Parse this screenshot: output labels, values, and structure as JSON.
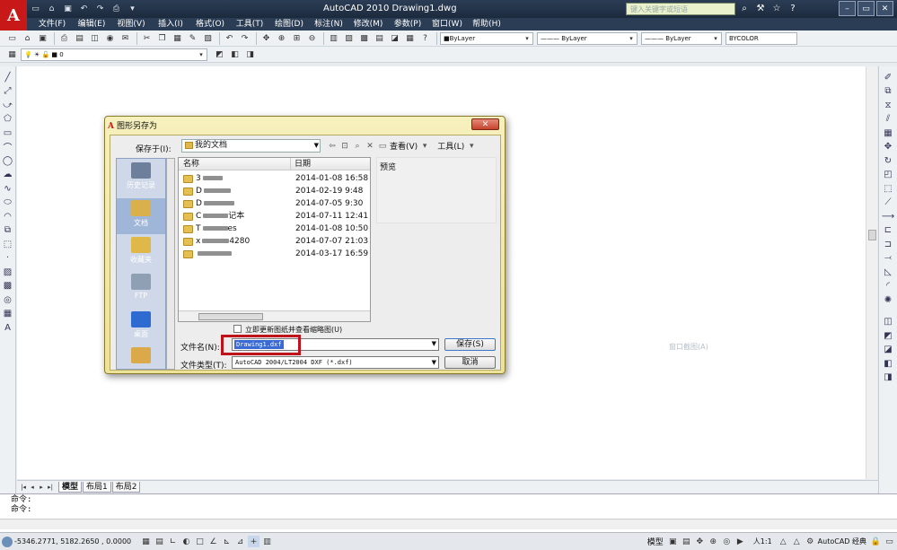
{
  "app": {
    "logo_letter": "A",
    "title": "AutoCAD 2010    Drawing1.dwg",
    "search_placeholder": "键入关键字或短语",
    "title_icons": [
      "binoculars-icon",
      "tools-icon",
      "star-icon",
      "help-icon"
    ],
    "window_buttons": [
      "–",
      "▭",
      "✕"
    ]
  },
  "menu": [
    "文件(F)",
    "编辑(E)",
    "视图(V)",
    "插入(I)",
    "格式(O)",
    "工具(T)",
    "绘图(D)",
    "标注(N)",
    "修改(M)",
    "参数(P)",
    "窗口(W)",
    "帮助(H)"
  ],
  "toolbar": {
    "color_value": "■ByLayer",
    "linetype_value": "——— ByLayer",
    "lineweight_value": "——— ByLayer",
    "plotstyle_value": "BYCOLOR",
    "layer_value": "■ 0"
  },
  "canvas": {
    "floating_label": "窗口截图(A)"
  },
  "layout_tabs": [
    "模型",
    "布局1",
    "布局2"
  ],
  "command": {
    "line1": "命令:",
    "line2": "命令:"
  },
  "status": {
    "coordinates": "-5346.2771, 5182.2650 , 0.0000",
    "model_label": "模型",
    "scale_label": "人1:1",
    "workspace_label": "AutoCAD 经典"
  },
  "dialog": {
    "title": "图形另存为",
    "close_label": "✕",
    "save_in_label": "保存于(I):",
    "save_in_value": "我的文档",
    "views_label": "查看(V)",
    "tools_label": "工具(L)",
    "places": [
      {
        "label": "历史记录",
        "color": "#6d7f9a"
      },
      {
        "label": "文档",
        "color": "#d9b04c"
      },
      {
        "label": "收藏夹",
        "color": "#e0b84a"
      },
      {
        "label": "FTP",
        "color": "#8f9fb4"
      },
      {
        "label": "桌面",
        "color": "#2d6bd0"
      }
    ],
    "col_name": "名称",
    "col_date": "日期",
    "files": [
      {
        "name": "3",
        "date": "2014-01-08 16:58"
      },
      {
        "name": "D",
        "date": "2014-02-19 9:48"
      },
      {
        "name": "D",
        "date": "2014-07-05 9:30"
      },
      {
        "name": "C",
        "suffix": "记本",
        "date": "2014-07-11 12:41"
      },
      {
        "name": "T",
        "suffix": "es",
        "date": "2014-01-08 10:50"
      },
      {
        "name": "x",
        "suffix": "4280",
        "date": "2014-07-07 21:03"
      },
      {
        "name": "",
        "date": "2014-03-17 16:59"
      }
    ],
    "preview_label": "预览",
    "thumbnail_label": "立即更新图纸并查看缩略图(U)",
    "filename_label": "文件名(N):",
    "filename_value": "Drawing1.dxf",
    "filetype_label": "文件类型(T):",
    "filetype_value": "AutoCAD 2004/LT2004 DXF (*.dxf)",
    "save_button": "保存(S)",
    "cancel_button": "取消"
  }
}
